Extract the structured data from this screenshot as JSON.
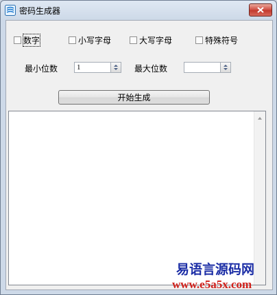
{
  "window": {
    "title": "密码生成器",
    "app_icon": "password-app-icon",
    "close_icon": "close-icon"
  },
  "options": [
    {
      "label": "数字",
      "checked": false
    },
    {
      "label": "小写字母",
      "checked": false
    },
    {
      "label": "大写字母",
      "checked": false
    },
    {
      "label": "特殊符号",
      "checked": false
    }
  ],
  "min_digits": {
    "label": "最小位数",
    "value": "1"
  },
  "max_digits": {
    "label": "最大位数",
    "value": ""
  },
  "start_button": {
    "label": "开始生成"
  },
  "output": {
    "text": ""
  },
  "watermark": {
    "name": "易语言源码网",
    "url": "www.e5a5x.com"
  },
  "colors": {
    "title_bg": "#dfe8f3",
    "close_red": "#c33a2e",
    "watermark_blue": "#1c2ea6",
    "watermark_red": "#d0201a"
  }
}
